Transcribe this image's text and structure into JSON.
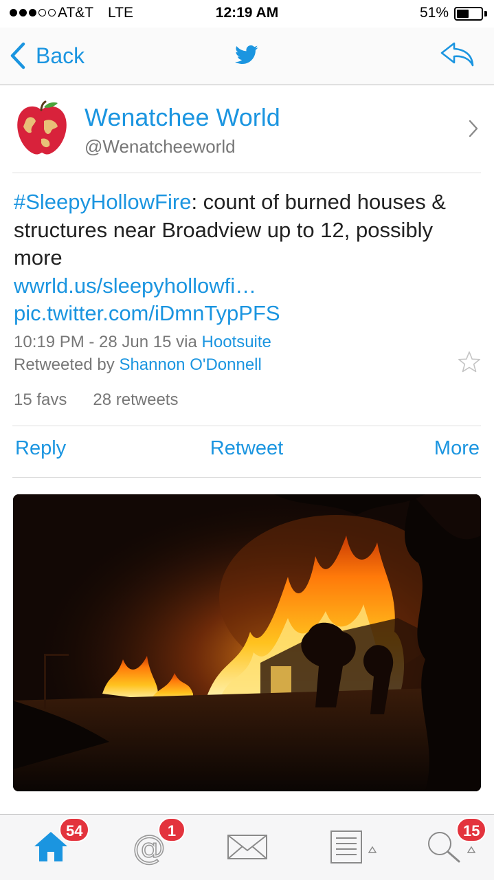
{
  "status_bar": {
    "carrier": "AT&T",
    "network": "LTE",
    "time": "12:19 AM",
    "battery_percent": "51%",
    "battery_level": 0.51,
    "signal_bars_filled": 3,
    "signal_bars_total": 5
  },
  "nav": {
    "back_label": "Back",
    "center_icon": "twitter-bird-icon",
    "right_icon": "reply-arrow-icon",
    "accent_color": "#1b95e0"
  },
  "profile": {
    "display_name": "Wenatchee World",
    "handle": "@Wenatcheeworld",
    "avatar_icon": "apple-globe-avatar"
  },
  "tweet": {
    "hashtag": "#SleepyHollowFire",
    "text": ": count of burned houses & structures near Broadview up to 12, possibly more",
    "link1": "wwrld.us/sleepyhollowfi…",
    "link2": "pic.twitter.com/iDmnTypPFS",
    "timestamp": "10:19 PM - 28 Jun 15",
    "via_prefix": "via",
    "via_app": "Hootsuite",
    "retweeted_prefix": "Retweeted by",
    "retweeted_by": "Shannon O'Donnell",
    "favs": "15 favs",
    "retweets": "28 retweets"
  },
  "actions": {
    "reply": "Reply",
    "retweet": "Retweet",
    "more": "More"
  },
  "tab_bar": {
    "home_badge": "54",
    "mentions_badge": "1",
    "search_badge": "15",
    "badge_color": "#e3333d"
  }
}
